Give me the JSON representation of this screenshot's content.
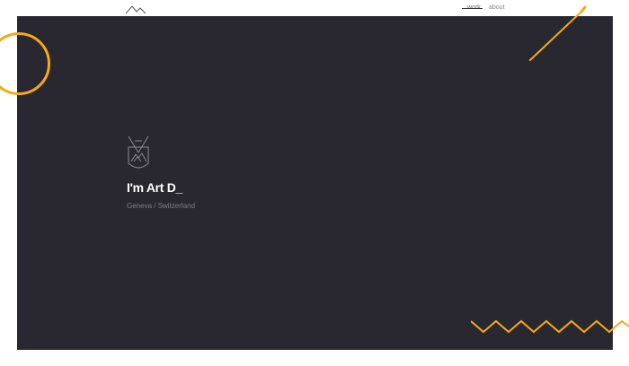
{
  "nav": {
    "items": [
      {
        "label": "work"
      },
      {
        "label": "about"
      }
    ]
  },
  "hero": {
    "title": "I'm Art D_",
    "location": "Geneva / Switzerland"
  },
  "colors": {
    "accent": "#f5a915",
    "panel": "#292730",
    "background": "#ffffff",
    "text": "#ffffff",
    "muted": "#7e7c86"
  },
  "icons": {
    "logo": "mountain-logo-icon",
    "crest": "crest-icon"
  }
}
